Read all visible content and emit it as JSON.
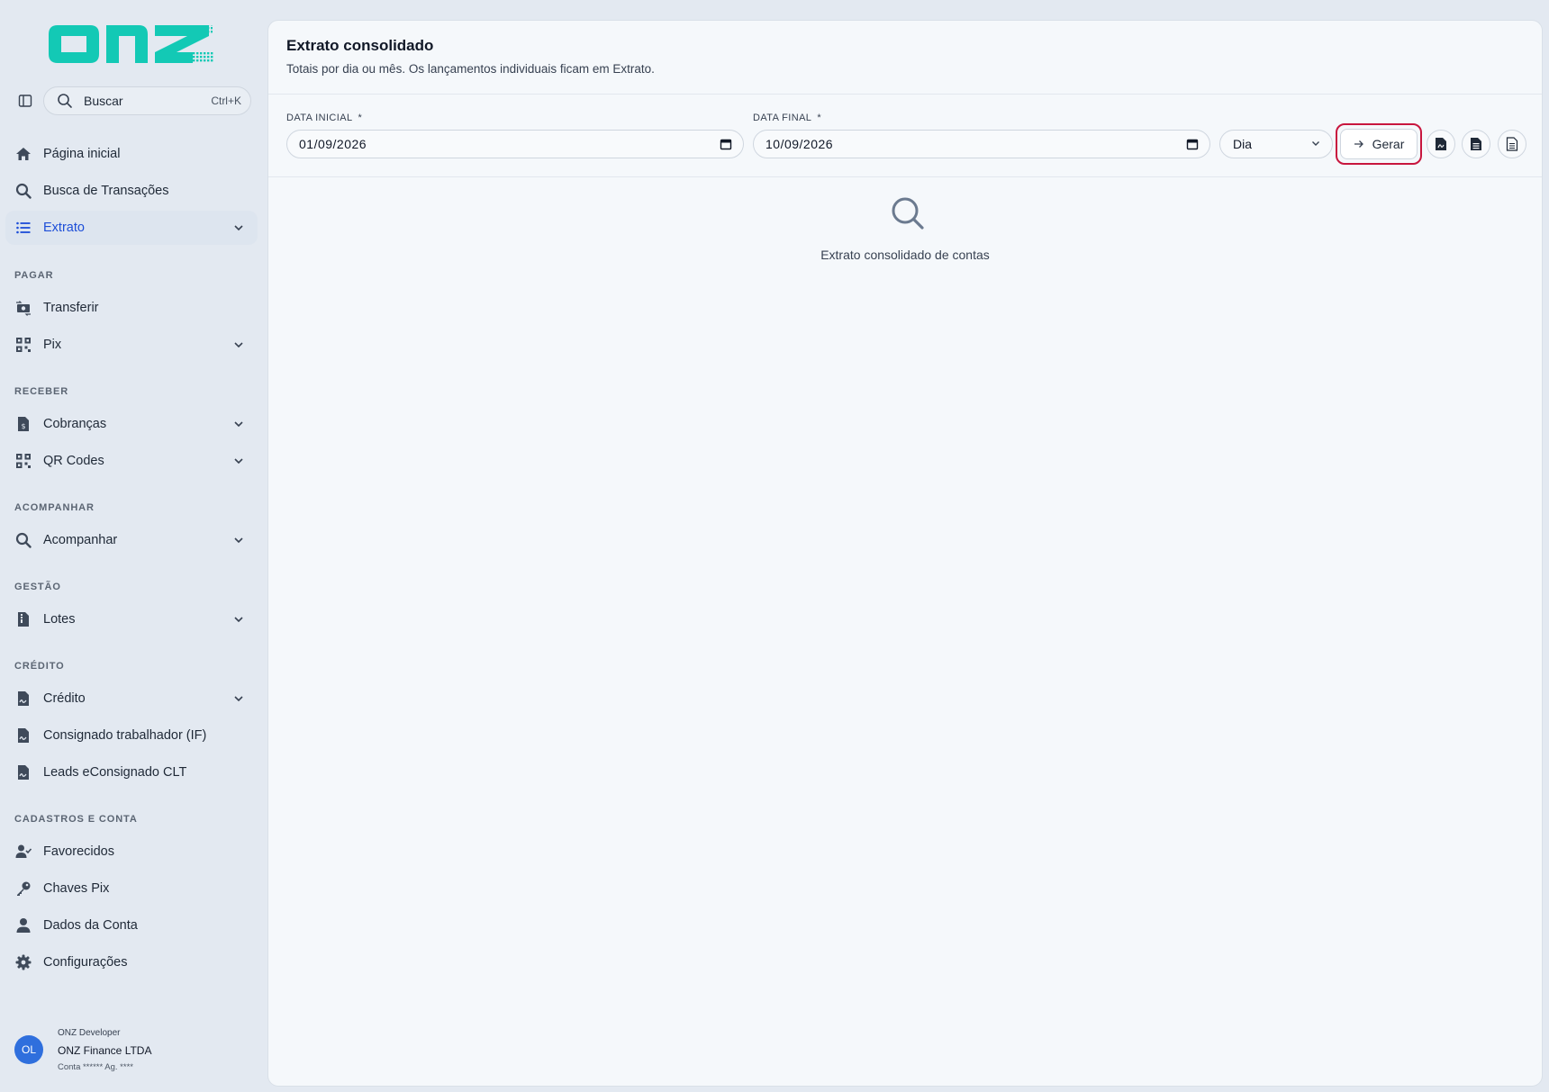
{
  "brand": {
    "logo_text": "onz",
    "accent": "#13c9b5"
  },
  "search": {
    "label": "Buscar",
    "shortcut": "Ctrl+K"
  },
  "nav": {
    "home": "Página inicial",
    "tx_search": "Busca de Transações",
    "statement": "Extrato",
    "sections": {
      "pay": "PAGAR",
      "receive": "RECEBER",
      "track": "ACOMPANHAR",
      "manage": "GESTÃO",
      "credit": "CRÉDITO",
      "account": "CADASTROS E CONTA"
    },
    "transfer": "Transferir",
    "pix": "Pix",
    "charges": "Cobranças",
    "qr_codes": "QR Codes",
    "track_item": "Acompanhar",
    "batches": "Lotes",
    "credit_item": "Crédito",
    "payroll_loan": "Consignado trabalhador (IF)",
    "leads": "Leads eConsignado CLT",
    "favorites": "Favorecidos",
    "pix_keys": "Chaves Pix",
    "account_data": "Dados da Conta",
    "settings": "Configurações"
  },
  "user": {
    "initials": "OL",
    "role": "ONZ Developer",
    "company": "ONZ Finance LTDA",
    "account": "Conta ****** Ag. ****"
  },
  "page": {
    "title": "Extrato consolidado",
    "subtitle": "Totais por dia ou mês. Os lançamentos individuais ficam em Extrato."
  },
  "filters": {
    "start_label": "DATA INICIAL",
    "start_value": "01/09/2026",
    "end_label": "DATA FINAL",
    "end_value": "10/09/2026",
    "required_mark": "*",
    "granularity": "Dia",
    "generate_label": "Gerar"
  },
  "empty_state": {
    "text": "Extrato consolidado de contas"
  },
  "colors": {
    "active_nav": "#1d4ed8",
    "focus_ring": "#c8163e",
    "avatar": "#2f6fdd"
  }
}
